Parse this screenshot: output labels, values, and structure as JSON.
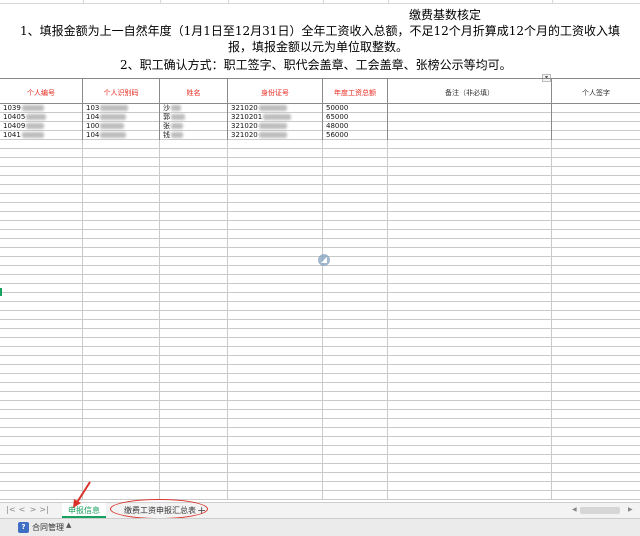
{
  "sheet": {
    "title": "缴费基数核定",
    "note_1a": "1、填报金额为上一自然年度（1月1日至12月31日）全年工资收入总额，不足12个月折算成12个月的工资收入填",
    "note_1b": "报，填报金额以元为单位取整数。",
    "note_2": "2、职工确认方式：职工签字、职代会盖章、工会盖章、张榜公示等均可。",
    "columns": [
      "个人编号",
      "个人识别码",
      "姓名",
      "身份证号",
      "年度工资总额",
      "备注（非必填）",
      "个人签字"
    ],
    "rows": [
      {
        "id": "1039",
        "code": "103",
        "name": "沙",
        "idno": "321020",
        "salary": "50000"
      },
      {
        "id": "10405",
        "code": "104",
        "name": "郭",
        "idno": "3210201",
        "salary": "65000"
      },
      {
        "id": "10409",
        "code": "100",
        "name": "张",
        "idno": "321020",
        "salary": "48000"
      },
      {
        "id": "1041",
        "code": "104",
        "name": "钱",
        "idno": "321020",
        "salary": "56000"
      }
    ]
  },
  "tabs": {
    "nav_first": "|<",
    "nav_prev": "<",
    "nav_next": ">",
    "nav_last": ">|",
    "active": "申报信息",
    "other": "缴费工资申报汇总表",
    "add": "+"
  },
  "taskbar": {
    "app_icon": "help-icon",
    "app_icon_glyph": "?",
    "label": "合同管理",
    "caret": "▲"
  },
  "colors": {
    "header_text": "#e8281e",
    "active_tab": "#19a15f",
    "annotation": "#d9322b"
  }
}
